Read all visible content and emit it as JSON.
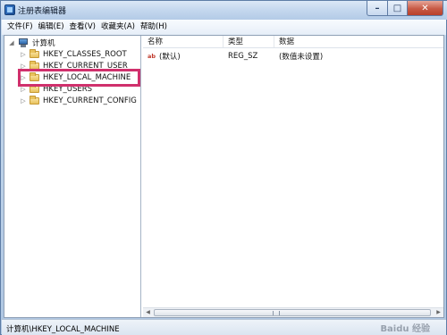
{
  "window": {
    "title": "注册表编辑器"
  },
  "menu": [
    "文件(F)",
    "编辑(E)",
    "查看(V)",
    "收藏夹(A)",
    "帮助(H)"
  ],
  "tree": {
    "root": "计算机",
    "items": [
      {
        "label": "HKEY_CLASSES_ROOT"
      },
      {
        "label": "HKEY_CURRENT_USER"
      },
      {
        "label": "HKEY_LOCAL_MACHINE"
      },
      {
        "label": "HKEY_USERS"
      },
      {
        "label": "HKEY_CURRENT_CONFIG"
      }
    ]
  },
  "list": {
    "headers": {
      "name": "名称",
      "type": "类型",
      "data": "数据"
    },
    "rows": [
      {
        "name": "(默认)",
        "type": "REG_SZ",
        "data": "(数值未设置)",
        "icon": "ab-icon"
      }
    ]
  },
  "status": {
    "path": "计算机\\HKEY_LOCAL_MACHINE"
  },
  "watermark": "Baidu 经验",
  "colors": {
    "highlight": "#d0306c",
    "titlebar": "#c4d7ee",
    "close_button": "#c75a45"
  }
}
